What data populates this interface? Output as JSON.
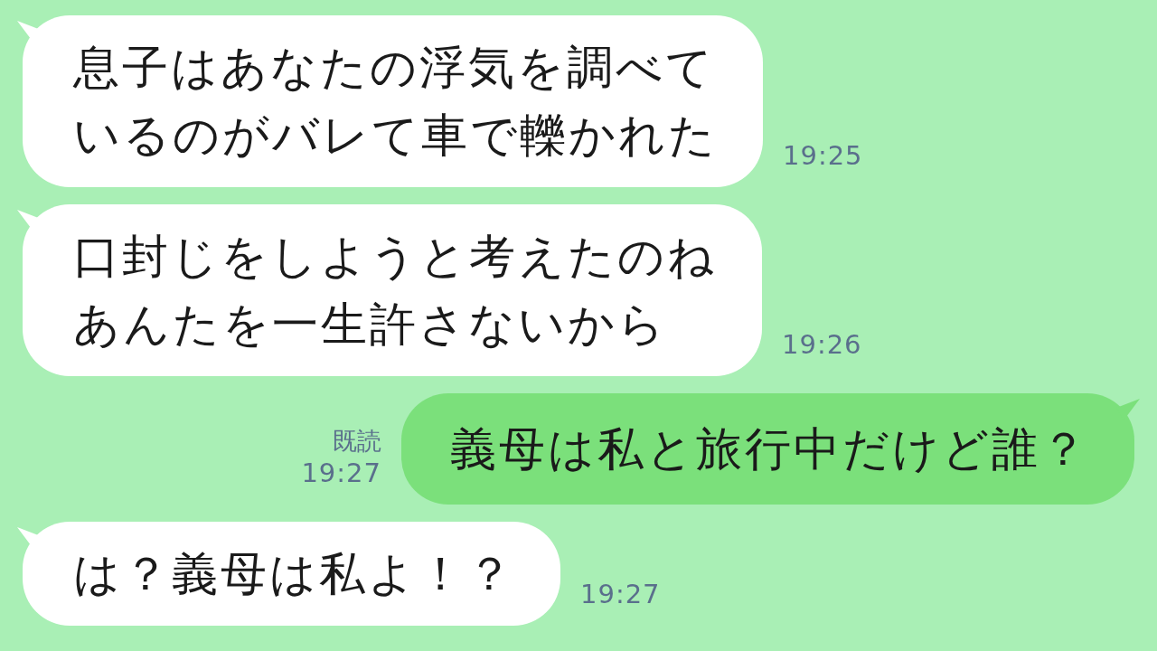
{
  "messages": [
    {
      "kind": "incoming",
      "lines": [
        "息子はあなたの浮気を調べて",
        "いるのがバレて車で轢かれた"
      ],
      "time": "19:25"
    },
    {
      "kind": "incoming",
      "lines": [
        "口封じをしようと考えたのね",
        "あんたを一生許さないから"
      ],
      "time": "19:26"
    },
    {
      "kind": "outgoing",
      "lines": [
        "義母は私と旅行中だけど誰？"
      ],
      "time": "19:27",
      "read_label": "既読"
    },
    {
      "kind": "incoming",
      "lines": [
        "は？義母は私よ！？"
      ],
      "time": "19:27"
    }
  ]
}
